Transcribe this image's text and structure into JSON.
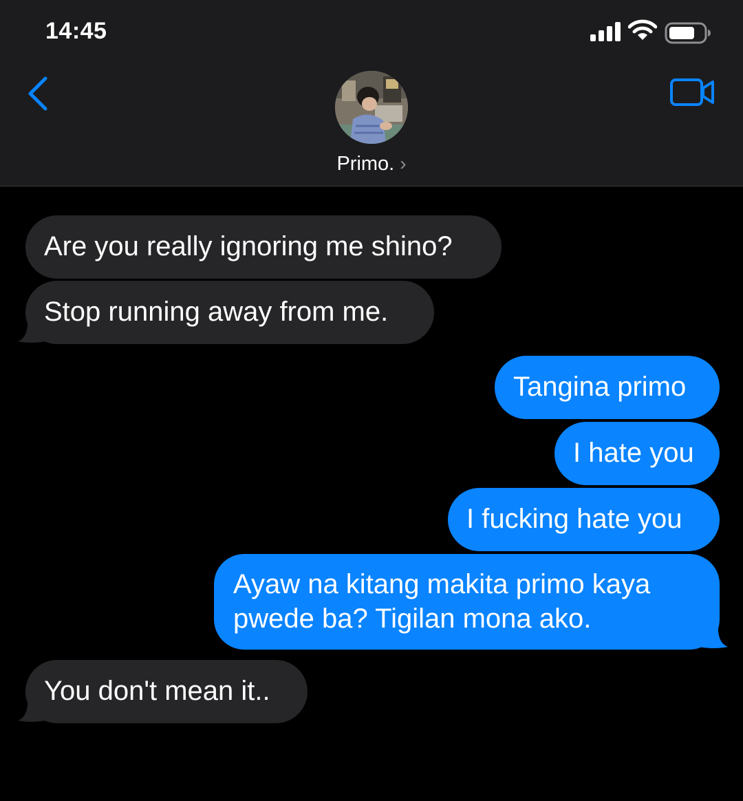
{
  "status_bar": {
    "time": "14:45"
  },
  "header": {
    "contact_name": "Primo.",
    "back_icon": "chevron-left-icon",
    "video_icon": "video-camera-icon",
    "accent_color": "#0a84ff"
  },
  "messages": [
    {
      "from": "them",
      "text": "Are you really ignoring me shino?"
    },
    {
      "from": "them",
      "text": "Stop running away from me."
    },
    {
      "from": "me",
      "text": "Tangina primo"
    },
    {
      "from": "me",
      "text": "I hate you"
    },
    {
      "from": "me",
      "text": "I fucking hate you"
    },
    {
      "from": "me",
      "text": "Ayaw na kitang makita primo kaya pwede ba? Tigilan mona ako."
    },
    {
      "from": "them",
      "text": "You don't mean it.."
    }
  ],
  "colors": {
    "incoming_bubble": "#262628",
    "outgoing_bubble": "#0a84ff",
    "background": "#000000",
    "header_background": "#1c1c1e"
  }
}
